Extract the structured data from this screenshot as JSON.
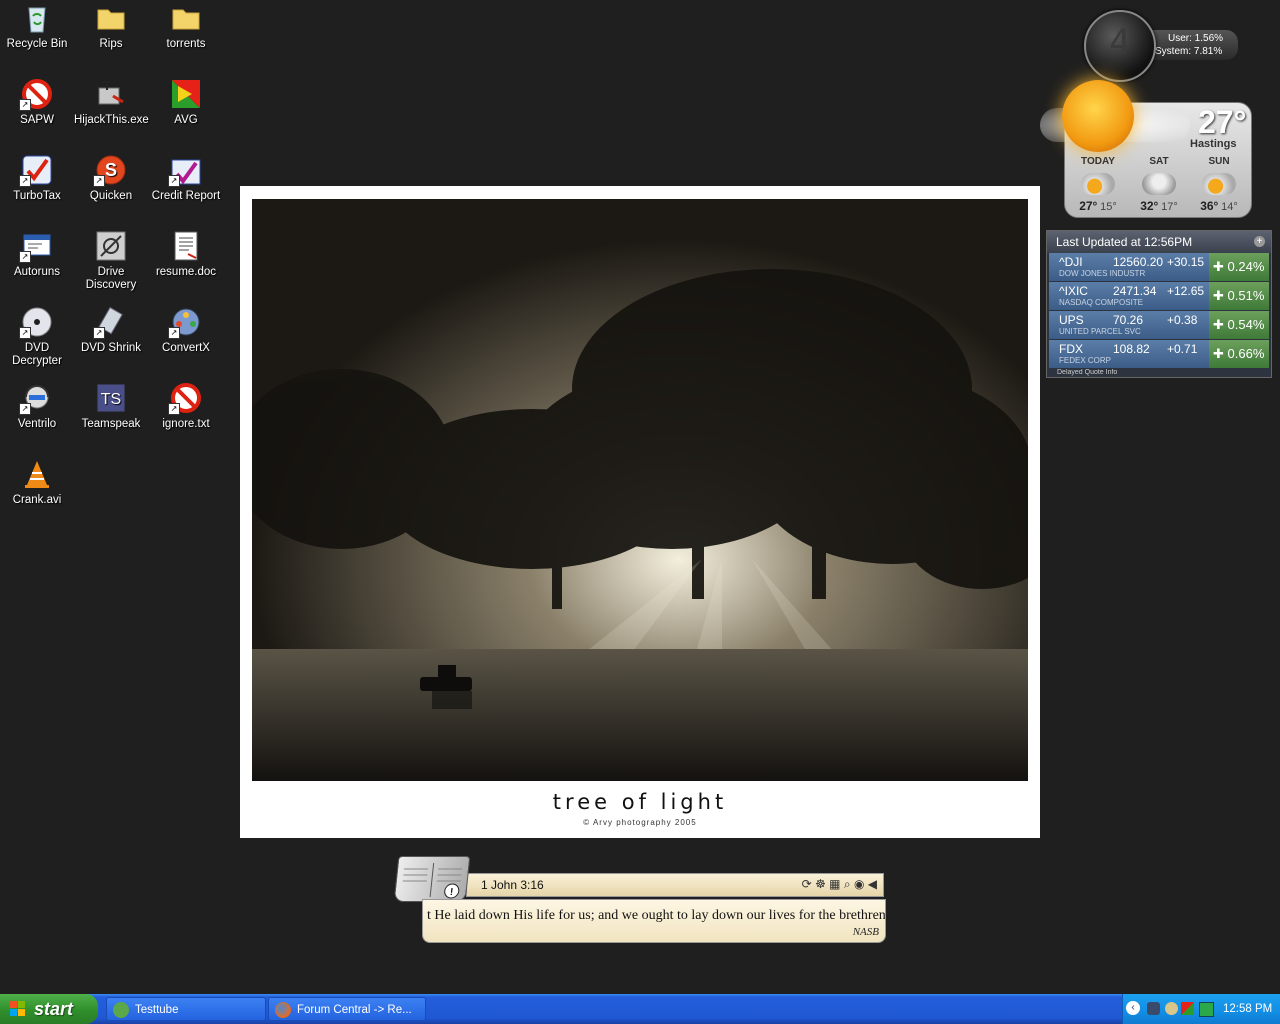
{
  "desktop_icons": {
    "recycle_bin": "Recycle Bin",
    "rips": "Rips",
    "torrents": "torrents",
    "sapw": "SAPW",
    "hijackthis": "HijackThis.exe",
    "avg": "AVG",
    "turbotax": "TurboTax",
    "quicken": "Quicken",
    "credit_report": "Credit Report",
    "autoruns": "Autoruns",
    "drive_discovery": "Drive Discovery",
    "resume": "resume.doc",
    "dvd_decrypter": "DVD Decrypter",
    "dvd_shrink": "DVD Shrink",
    "convertx": "ConvertX",
    "ventrilo": "Ventrilo",
    "teamspeak": "Teamspeak",
    "ignore": "ignore.txt",
    "crank": "Crank.avi"
  },
  "wallpaper": {
    "title": "tree of light",
    "credit": "© Arvy photography 2005"
  },
  "cpu_widget": {
    "digit": "4",
    "user": "User: 1.56%",
    "system": "System: 7.81%"
  },
  "weather": {
    "current_temp": "27°",
    "city": "Hastings",
    "days": [
      {
        "name": "TODAY",
        "hi": "27°",
        "lo": "15°",
        "icon": "partly-sunny-icon"
      },
      {
        "name": "SAT",
        "hi": "32°",
        "lo": "17°",
        "icon": "rain-cloud-icon"
      },
      {
        "name": "SUN",
        "hi": "36°",
        "lo": "14°",
        "icon": "partly-sunny-icon"
      }
    ]
  },
  "stocks": {
    "header": "Last Updated at 12:56PM",
    "footer": "Delayed Quote Info",
    "rows": [
      {
        "symbol": "^DJI",
        "price": "12560.20",
        "change": "+30.15",
        "name": "DOW JONES INDUSTR",
        "pct": "0.24%"
      },
      {
        "symbol": "^IXIC",
        "price": "2471.34",
        "change": "+12.65",
        "name": "NASDAQ COMPOSITE",
        "pct": "0.51%"
      },
      {
        "symbol": "UPS",
        "price": "70.26",
        "change": "+0.38",
        "name": "UNITED PARCEL SVC",
        "pct": "0.54%"
      },
      {
        "symbol": "FDX",
        "price": "108.82",
        "change": "+0.71",
        "name": "FEDEX CORP",
        "pct": "0.66%"
      }
    ],
    "accent_up": "#4a8a40"
  },
  "bible": {
    "reference": "1 John 3:16",
    "verse": "t He laid down His life for us; and we ought to lay down our lives for the brethren",
    "version": "NASB"
  },
  "taskbar": {
    "start": "start",
    "tasks": [
      {
        "label": "Testtube"
      },
      {
        "label": "Forum Central -> Re..."
      }
    ],
    "clock": "12:58 PM"
  },
  "colors": {
    "desktop_bg": "#1f1f1f",
    "taskbar_blue": "#245edb",
    "start_green": "#2f8f2b"
  }
}
